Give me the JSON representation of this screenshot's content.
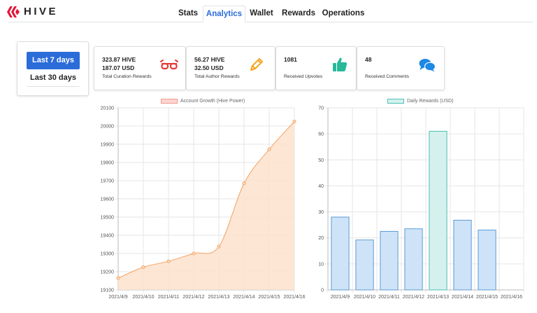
{
  "brand": {
    "name": "HIVE",
    "color": "#e31337"
  },
  "tabs": [
    {
      "label": "Stats",
      "active": false
    },
    {
      "label": "Analytics",
      "active": true
    },
    {
      "label": "Wallet",
      "active": false
    },
    {
      "label": "Rewards",
      "active": false
    },
    {
      "label": "Operations",
      "active": false
    }
  ],
  "period": {
    "primary": "Last 7 days",
    "secondary": "Last 30 days"
  },
  "cards": [
    {
      "value1": "323.87 HIVE",
      "value2": "187.07 USD",
      "label": "Total Curation Rewards",
      "icon": "glasses-icon",
      "color": "#e53935"
    },
    {
      "value1": "56.27 HIVE",
      "value2": "32.50 USD",
      "label": "Total Author Rewards",
      "icon": "pencil-icon",
      "color": "#f5a623"
    },
    {
      "value1": "1081",
      "value2": "",
      "label": "Received Upvotes",
      "icon": "thumbs-up-icon",
      "color": "#26b99a"
    },
    {
      "value1": "48",
      "value2": "",
      "label": "Received Comments",
      "icon": "comments-icon",
      "color": "#1e88e5"
    }
  ],
  "chart_data": [
    {
      "type": "area",
      "series": [
        {
          "name": "Account Growth (Hive Power)",
          "values": [
            19165,
            19225,
            19257,
            19300,
            19338,
            19685,
            19872,
            20025
          ]
        }
      ],
      "x": [
        "2021/4/9",
        "2021/4/10",
        "2021/4/11",
        "2021/4/12",
        "2021/4/13",
        "2021/4/14",
        "2021/4/15",
        "2021/4/16"
      ],
      "yticks": [
        "20100",
        "20000",
        "19900",
        "19800",
        "19700",
        "19600",
        "19500",
        "19400",
        "19300",
        "19200",
        "19100"
      ],
      "ylim": [
        19100,
        20100
      ],
      "grid": true,
      "legend": "top",
      "line_color": "#f4a261",
      "fill_color": "#fde2cc"
    },
    {
      "type": "bar",
      "series": [
        {
          "name": "Daily Rewards (USD)",
          "values": [
            28,
            19.2,
            22.5,
            23.5,
            61,
            26.8,
            23,
            0
          ]
        }
      ],
      "categories": [
        "2021/4/9",
        "2021/4/10",
        "2021/4/11",
        "2021/4/12",
        "2021/4/13",
        "2021/4/14",
        "2021/4/15",
        "2021/4/16"
      ],
      "yticks": [
        "70",
        "60",
        "50",
        "40",
        "30",
        "20",
        "10",
        "0"
      ],
      "ylim": [
        0,
        70
      ],
      "grid": true,
      "legend": "top",
      "bar_fill": "#cfe3f8",
      "bar_stroke": "#5b9bd5",
      "highlight_index": 4,
      "highlight_fill": "#d4f1ee",
      "highlight_stroke": "#4fc0b4"
    }
  ]
}
